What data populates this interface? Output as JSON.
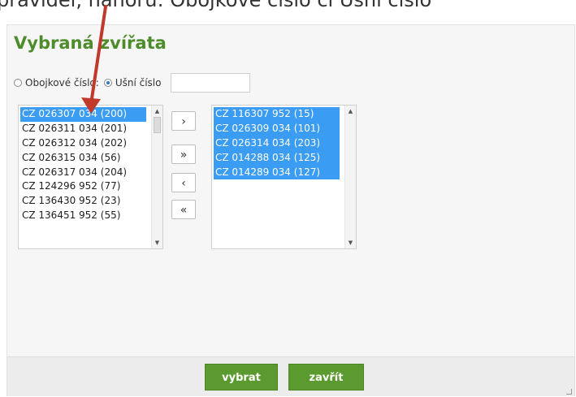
{
  "top_partial_text": "pravidel, nahoru: Obojkové číslo či Ušní číslo",
  "dialog": {
    "title": "Vybraná zvířata",
    "radios": [
      {
        "label": "Obojkové číslo:",
        "checked": false
      },
      {
        "label": "Ušní číslo",
        "checked": true
      }
    ],
    "ear_number_value": ""
  },
  "left_list": {
    "items": [
      {
        "label": "CZ 026307 034 (200)",
        "selected": true
      },
      {
        "label": "CZ 026311 034 (201)",
        "selected": false
      },
      {
        "label": "CZ 026312 034 (202)",
        "selected": false
      },
      {
        "label": "CZ 026315 034 (56)",
        "selected": false
      },
      {
        "label": "CZ 026317 034 (204)",
        "selected": false
      },
      {
        "label": "CZ 124296 952 (77)",
        "selected": false
      },
      {
        "label": "CZ 136430 952 (23)",
        "selected": false
      },
      {
        "label": "CZ 136451 952 (55)",
        "selected": false
      }
    ]
  },
  "right_list": {
    "items": [
      {
        "label": "CZ 116307 952 (15)",
        "selected": true
      },
      {
        "label": "CZ 026309 034 (101)",
        "selected": true
      },
      {
        "label": "CZ 026314 034 (203)",
        "selected": true
      },
      {
        "label": "CZ 014288 034 (125)",
        "selected": true
      },
      {
        "label": "CZ 014289 034 (127)",
        "selected": true
      }
    ]
  },
  "move_buttons": [
    {
      "label": "›"
    },
    {
      "label": "»"
    },
    {
      "label": "‹"
    },
    {
      "label": "«"
    }
  ],
  "footer": {
    "select_label": "vybrat",
    "close_label": "zavřít"
  },
  "colors": {
    "title_green": "#4e8b2a",
    "button_green": "#5b9a2f",
    "selection_blue": "#3b9cf3",
    "arrow_red": "#c0392b"
  },
  "icons": {
    "scroll_up": "scroll-up-icon",
    "scroll_down": "scroll-down-icon",
    "annotation_arrow": "red-arrow-icon"
  }
}
